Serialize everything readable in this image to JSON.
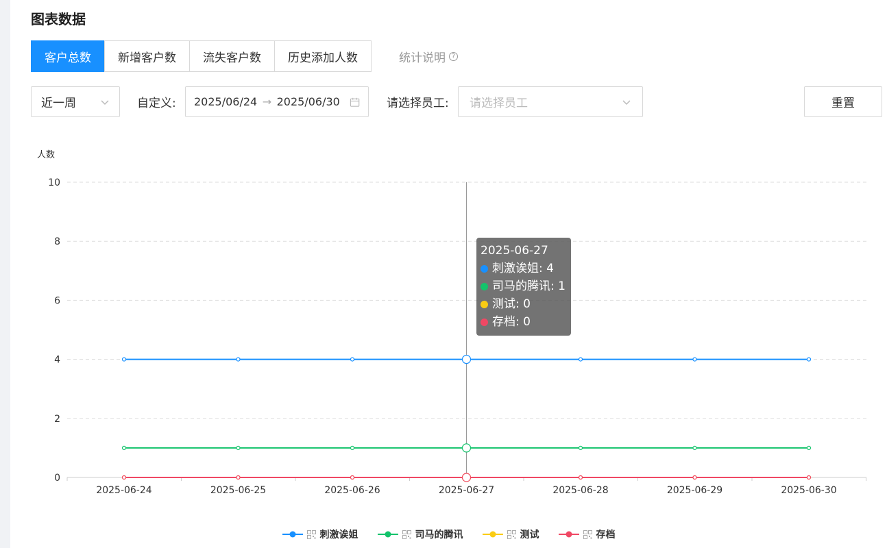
{
  "page_title": "图表数据",
  "tabs": [
    {
      "label": "客户总数",
      "active": true
    },
    {
      "label": "新增客户数",
      "active": false
    },
    {
      "label": "流失客户数",
      "active": false
    },
    {
      "label": "历史添加人数",
      "active": false
    }
  ],
  "stat_note": "统计说明",
  "filters": {
    "period": "近一周",
    "custom_label": "自定义:",
    "start_date": "2025/06/24",
    "end_date": "2025/06/30",
    "range_separator": "→",
    "staff_label": "请选择员工:",
    "staff_placeholder": "请选择员工",
    "reset_label": "重置"
  },
  "colors": {
    "accent": "#1890ff",
    "series_blue": "#1890ff",
    "series_green": "#13c36b",
    "series_yellow": "#facc14",
    "series_red": "#f04864"
  },
  "chart_data": {
    "type": "line",
    "ylabel": "人数",
    "ylim": [
      0,
      10
    ],
    "yticks": [
      0,
      2,
      4,
      6,
      8,
      10
    ],
    "categories": [
      "2025-06-24",
      "2025-06-25",
      "2025-06-26",
      "2025-06-27",
      "2025-06-28",
      "2025-06-29",
      "2025-06-30"
    ],
    "series": [
      {
        "name": "刺激诶姐",
        "color": "#1890ff",
        "values": [
          4,
          4,
          4,
          4,
          4,
          4,
          4
        ]
      },
      {
        "name": "司马的腾讯",
        "color": "#13c36b",
        "values": [
          1,
          1,
          1,
          1,
          1,
          1,
          1
        ]
      },
      {
        "name": "测试",
        "color": "#facc14",
        "values": [
          0,
          0,
          0,
          0,
          0,
          0,
          0
        ]
      },
      {
        "name": "存档",
        "color": "#f04864",
        "values": [
          0,
          0,
          0,
          0,
          0,
          0,
          0
        ]
      }
    ],
    "grid": true,
    "legend": "bottom-center",
    "hovered_category": "2025-06-27"
  },
  "tooltip": {
    "title": "2025-06-27",
    "rows": [
      {
        "text": "刺激诶姐: 4",
        "color": "#1890ff"
      },
      {
        "text": "司马的腾讯: 1",
        "color": "#13c36b"
      },
      {
        "text": "测试: 0",
        "color": "#facc14"
      },
      {
        "text": "存档: 0",
        "color": "#f04864"
      }
    ]
  }
}
